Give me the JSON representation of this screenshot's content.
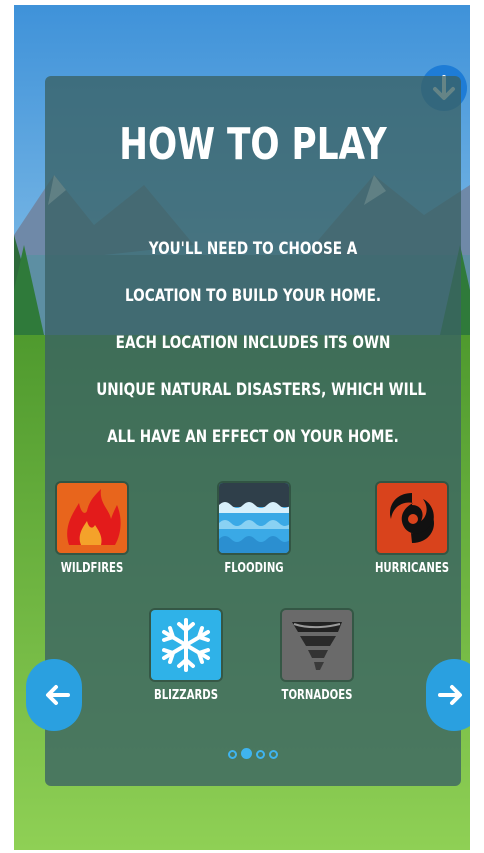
{
  "header": {
    "title": "HOW TO PLAY",
    "download_icon": "arrow-down-circle-icon"
  },
  "instructions": [
    "YOU'LL NEED TO CHOOSE A",
    "LOCATION TO BUILD YOUR HOME.",
    "EACH LOCATION INCLUDES ITS OWN",
    "UNIQUE NATURAL DISASTERS, WHICH WILL",
    "ALL HAVE AN EFFECT ON YOUR HOME."
  ],
  "disasters": [
    {
      "label": "WILDFIRES",
      "icon": "flame-icon",
      "color": "#e2571a"
    },
    {
      "label": "FLOODING",
      "icon": "water-waves-icon",
      "color": "#3aa9e6"
    },
    {
      "label": "HURRICANES",
      "icon": "hurricane-icon",
      "color": "#d9431c"
    },
    {
      "label": "BLIZZARDS",
      "icon": "snowflake-icon",
      "color": "#2fb2e8"
    },
    {
      "label": "TORNADOES",
      "icon": "tornado-icon",
      "color": "#5b5b5b"
    }
  ],
  "navigation": {
    "prev_icon": "arrow-left-icon",
    "next_icon": "arrow-right-icon",
    "accent": "#2aa0e0"
  },
  "pager": {
    "total": 4,
    "current": 2
  }
}
